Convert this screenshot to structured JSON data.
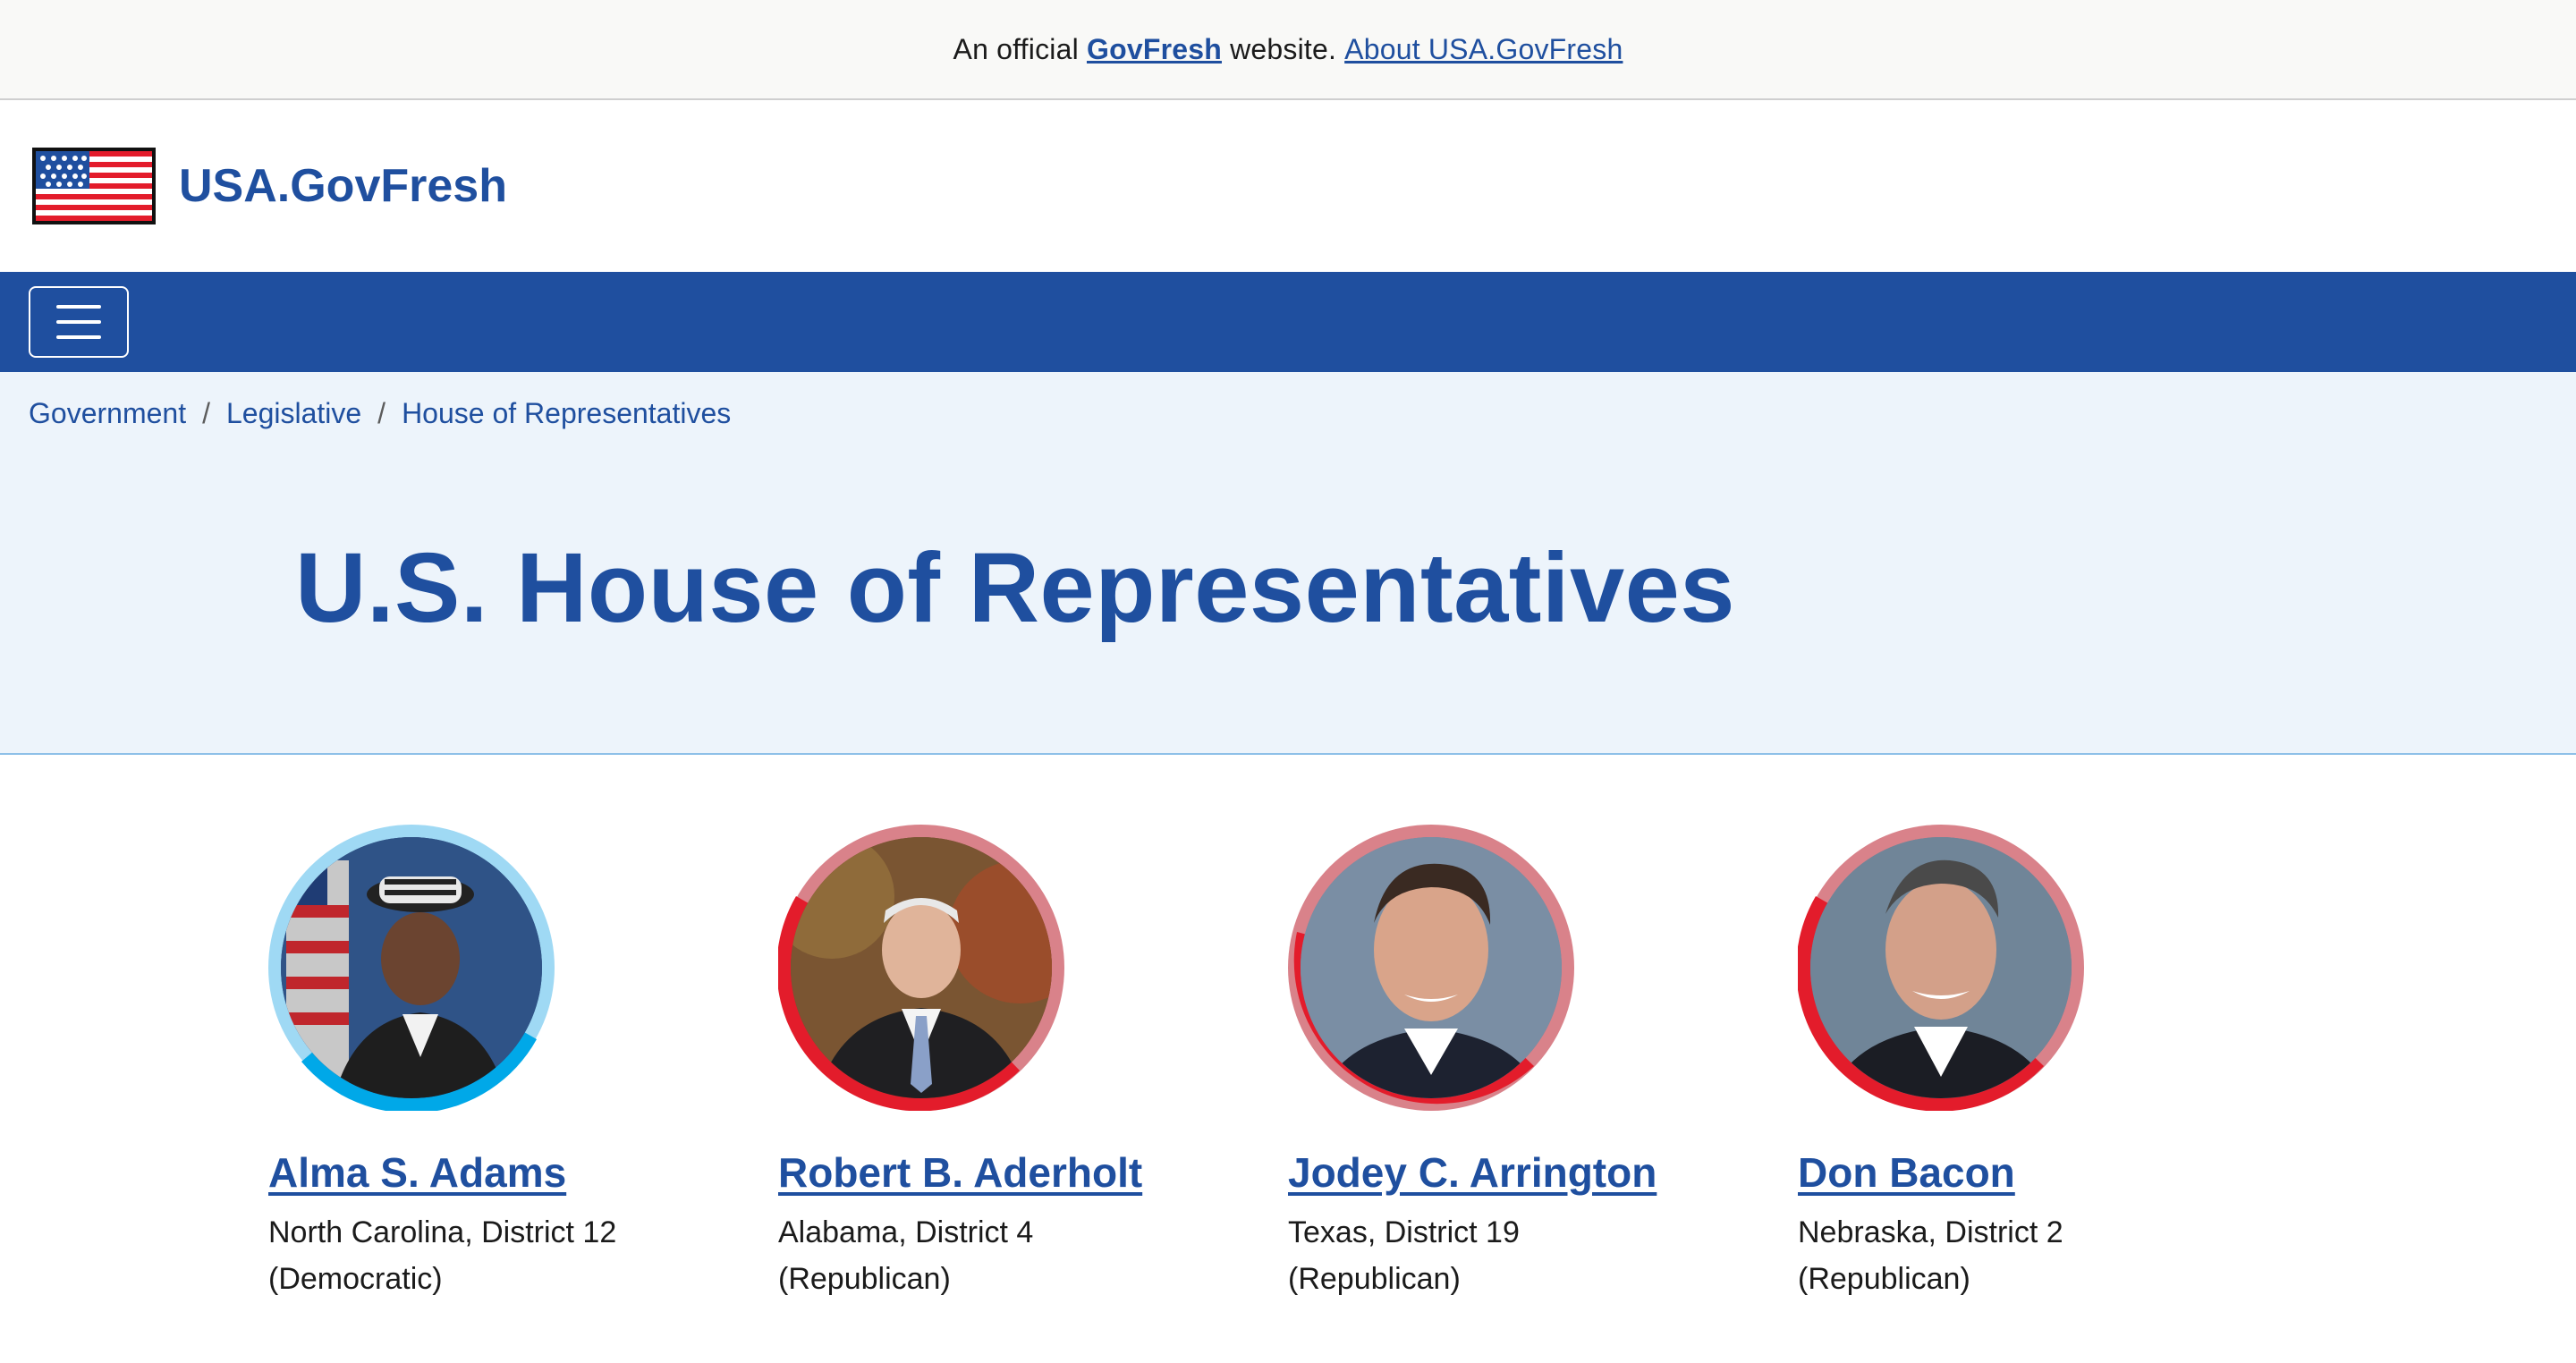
{
  "banner": {
    "prefix": "An official",
    "brand": "GovFresh",
    "suffix": "website.",
    "about_link": "About USA.GovFresh"
  },
  "header": {
    "site_title": "USA.GovFresh",
    "logo_icon": "us-flag-icon"
  },
  "nav": {
    "menu_icon": "hamburger-menu-icon",
    "color": "#1f4f9f"
  },
  "breadcrumb": [
    "Government",
    "Legislative",
    "House of Representatives"
  ],
  "page": {
    "title": "U.S. House of Representatives"
  },
  "colors": {
    "democratic": "#00a8e8",
    "democratic_light": "#9fd9f4",
    "republican": "#e31c2b",
    "republican_light": "#d9828a",
    "link": "#1f4f9f",
    "hero_bg": "#edf4fb"
  },
  "members": [
    {
      "name": "Alma S. Adams",
      "info": "North Carolina, District 12 (Democratic)",
      "party": "democratic"
    },
    {
      "name": "Robert B. Aderholt",
      "info": "Alabama, District 4 (Republican)",
      "party": "republican"
    },
    {
      "name": "Jodey C. Arrington",
      "info": "Texas, District 19 (Republican)",
      "party": "republican"
    },
    {
      "name": "Don Bacon",
      "info": "Nebraska, District 2 (Republican)",
      "party": "republican"
    }
  ]
}
